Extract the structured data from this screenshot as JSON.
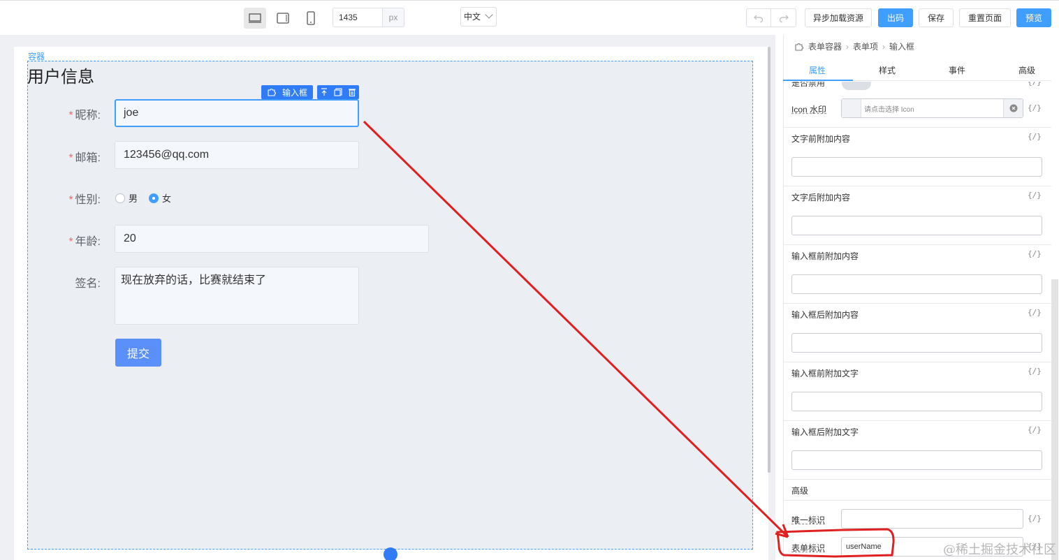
{
  "toolbar": {
    "width_value": "1435",
    "width_unit": "px",
    "language": "中文",
    "buttons": {
      "async_load": "异步加载资源",
      "export_code": "出码",
      "save": "保存",
      "reset_page": "重置页面",
      "preview": "预览"
    }
  },
  "canvas": {
    "container_label": "容器",
    "form_title": "用户信息",
    "selected_component": "输入框",
    "fields": {
      "nickname": {
        "label": "昵称:",
        "value": "joe",
        "required": "*"
      },
      "email": {
        "label": "邮箱:",
        "value": "123456@qq.com",
        "required": "*"
      },
      "gender": {
        "label": "性别:",
        "required": "*",
        "options": [
          "男",
          "女"
        ],
        "selected": "女"
      },
      "age": {
        "label": "年龄:",
        "value": "20",
        "required": "*"
      },
      "signature": {
        "label": "签名:",
        "value": "现在放弃的话，比赛就结束了"
      }
    },
    "submit_label": "提交"
  },
  "panel": {
    "breadcrumb": [
      "表单容器",
      "表单项",
      "输入框"
    ],
    "tabs": [
      "属性",
      "样式",
      "事件",
      "高级"
    ],
    "active_tab": "属性",
    "cut_label": "是否禁用",
    "icon_label": "Icon 水印",
    "icon_placeholder": "请点击选择 Icon",
    "bind_glyph": "{/}",
    "props": [
      "文字前附加内容",
      "文字后附加内容",
      "输入框前附加内容",
      "输入框后附加内容",
      "输入框前附加文字",
      "输入框后附加文字"
    ],
    "advanced_title": "高级",
    "unique_id_label": "唯一标识",
    "form_id_label": "表单标识",
    "form_id_value": "userName"
  },
  "watermark": "@稀土掘金技术社区",
  "colors": {
    "accent": "#409eff",
    "annotation": "#e02020"
  }
}
